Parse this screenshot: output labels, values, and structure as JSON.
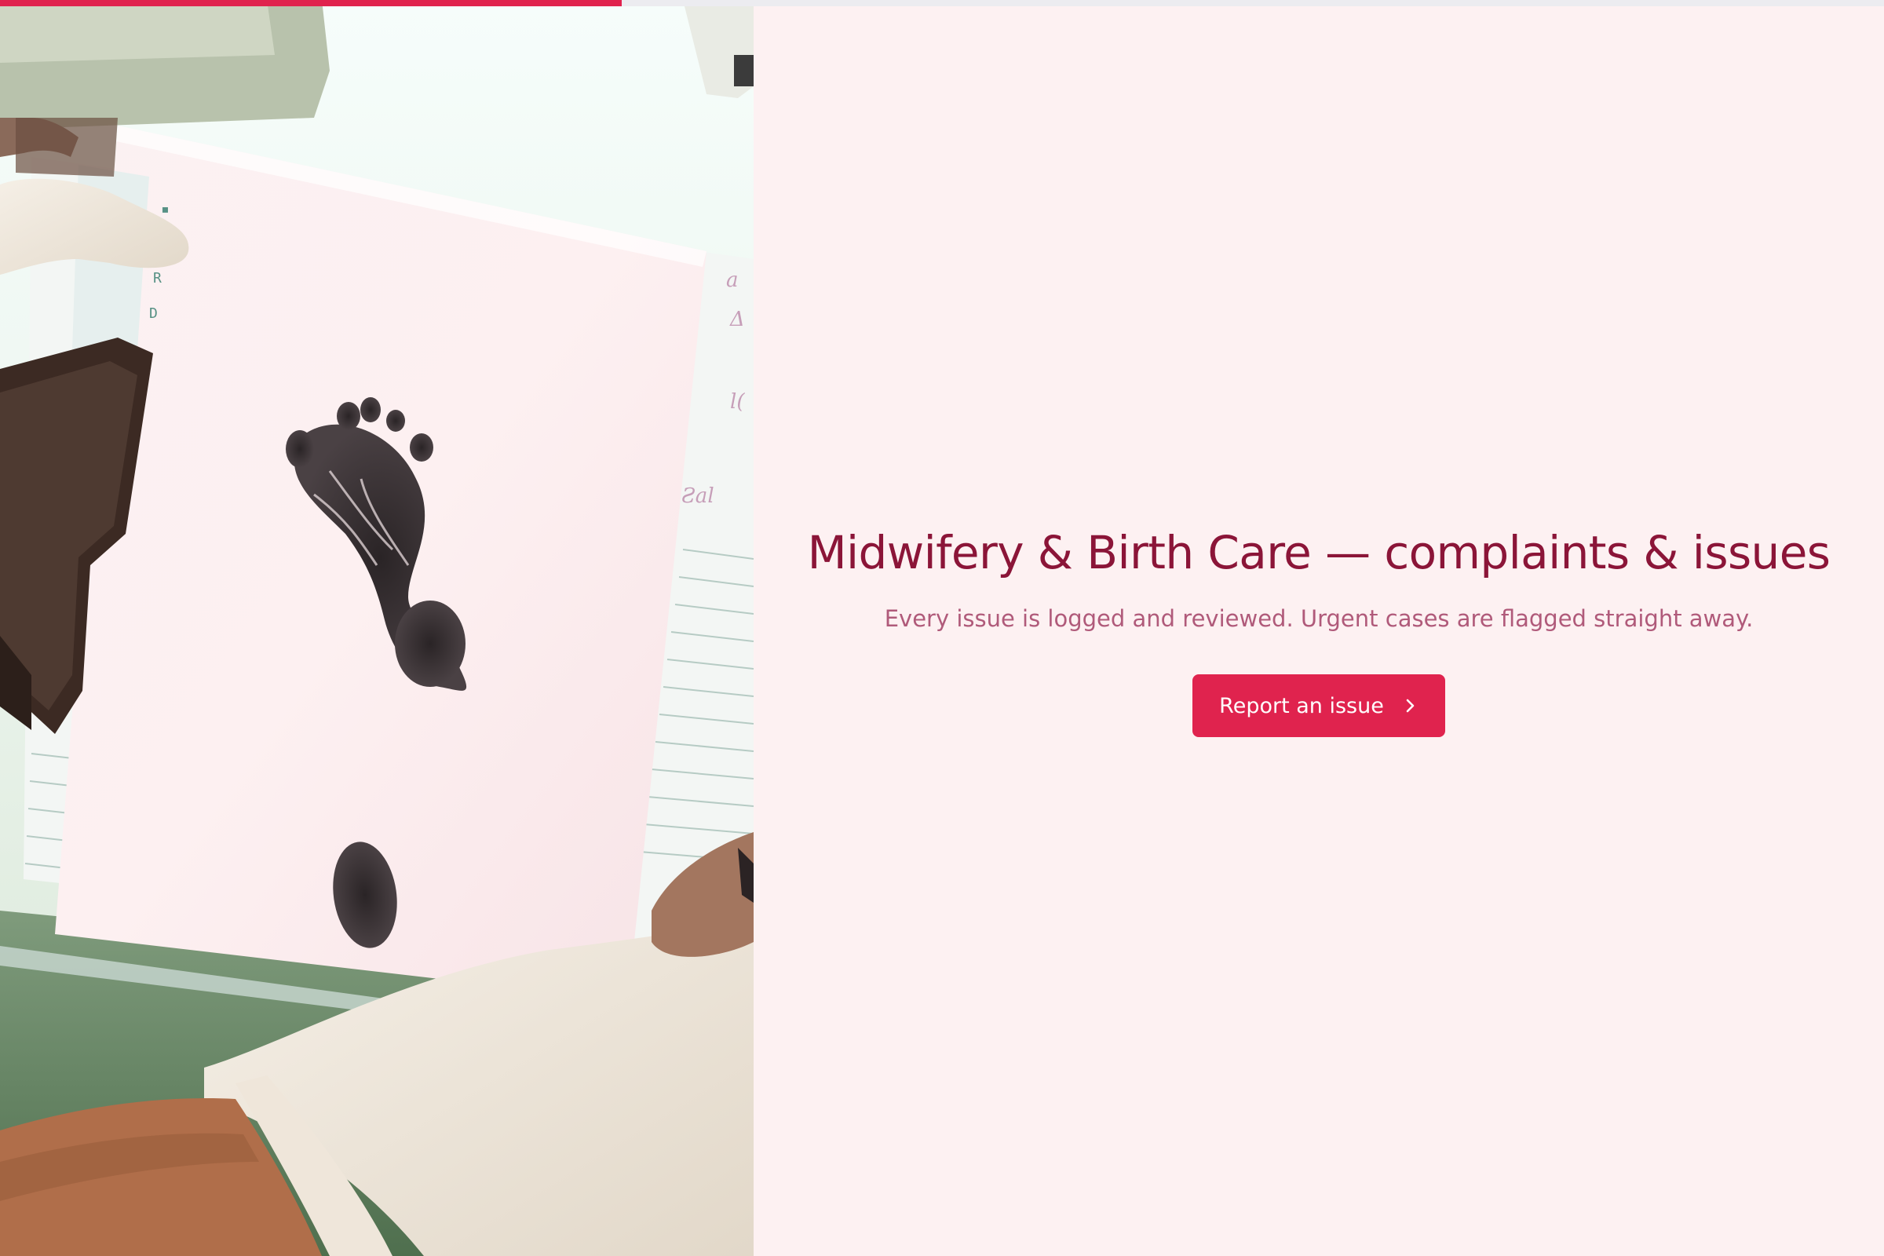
{
  "progress": {
    "percent": 33,
    "fill_color": "#e0234e",
    "track_color": "#ececf0"
  },
  "hero_image": {
    "alt": "Newborn footprint being stamped on a birth record"
  },
  "main": {
    "title": "Midwifery & Birth Care — complaints & issues",
    "subtitle": "Every issue is logged and reviewed. Urgent cases are flagged straight away.",
    "cta_label": "Report an issue",
    "cta_icon": "chevron-right-icon"
  },
  "colors": {
    "background": "#fdf1f2",
    "title": "#8b1538",
    "subtitle": "#b05a7a",
    "accent": "#e0234e"
  }
}
